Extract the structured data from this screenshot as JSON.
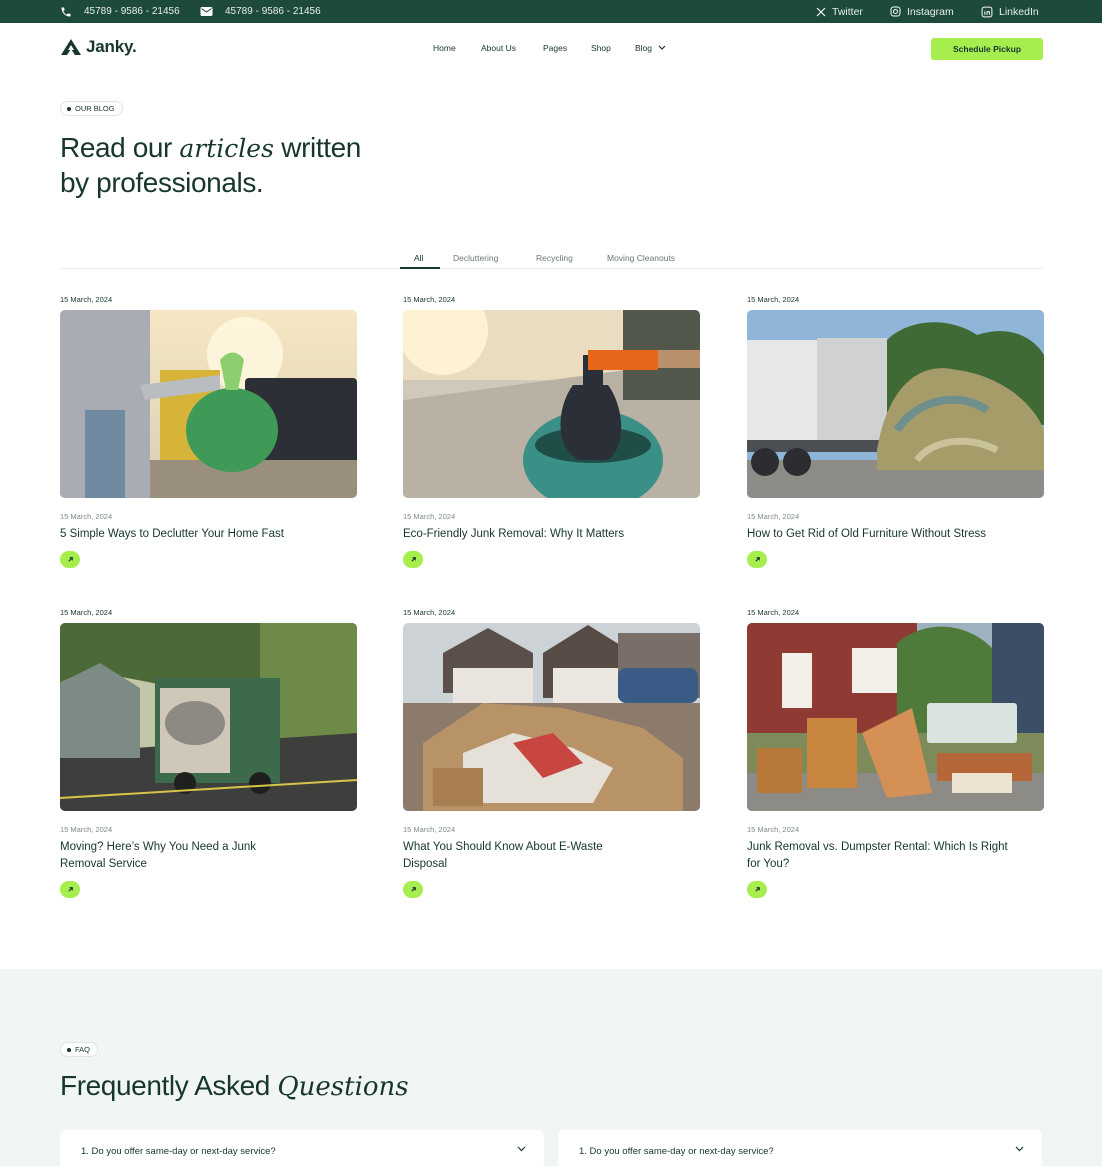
{
  "topbar": {
    "phone": "45789 - 9586 - 21456",
    "email": "45789 - 9586 - 21456",
    "social": [
      {
        "label": "Twitter",
        "icon": "x-twitter-icon"
      },
      {
        "label": "Instagram",
        "icon": "instagram-icon"
      },
      {
        "label": "LinkedIn",
        "icon": "linkedin-icon"
      }
    ]
  },
  "header": {
    "logo": "Janky.",
    "nav": [
      "Home",
      "About Us",
      "Pages",
      "Shop",
      "Blog"
    ],
    "cta": "Schedule Pickup"
  },
  "blog": {
    "badge": "OUR BLOG",
    "headline_part1": "Read our ",
    "headline_italic": "articles",
    "headline_part2": " written",
    "headline_line2": "by professionals.",
    "tabs": [
      "All",
      "Decluttering",
      "Recycling",
      "Moving Cleanouts"
    ],
    "active_tab": "All",
    "posts": [
      {
        "date": "15 March, 2024",
        "meta": "15 March, 2024",
        "title": "5 Simple Ways to Declutter Your Home Fast"
      },
      {
        "date": "15 March, 2024",
        "meta": "15 March, 2024",
        "title": "Eco-Friendly Junk Removal: Why It Matters"
      },
      {
        "date": "15 March, 2024",
        "meta": "15 March, 2024",
        "title": "How to Get Rid of Old Furniture Without Stress"
      },
      {
        "date": "15 March, 2024",
        "meta": "15 March, 2024",
        "title": "Moving? Here’s Why You Need a Junk Removal Service"
      },
      {
        "date": "15 March, 2024",
        "meta": "15 March, 2024",
        "title": "What You Should Know About E-Waste Disposal"
      },
      {
        "date": "15 March, 2024",
        "meta": "15 March, 2024",
        "title": "Junk Removal vs. Dumpster Rental: Which Is Right for You?"
      }
    ]
  },
  "faq": {
    "badge": "FAQ",
    "title_part1": "Frequently Asked ",
    "title_italic": "Questions",
    "questions": [
      "1. Do you offer same-day or next-day service?",
      "1. Do you offer same-day or next-day service?"
    ]
  },
  "colors": {
    "brand_dark": "#1d4a3c",
    "accent_green": "#a6ee4e",
    "faq_background": "#f2f6f3"
  }
}
